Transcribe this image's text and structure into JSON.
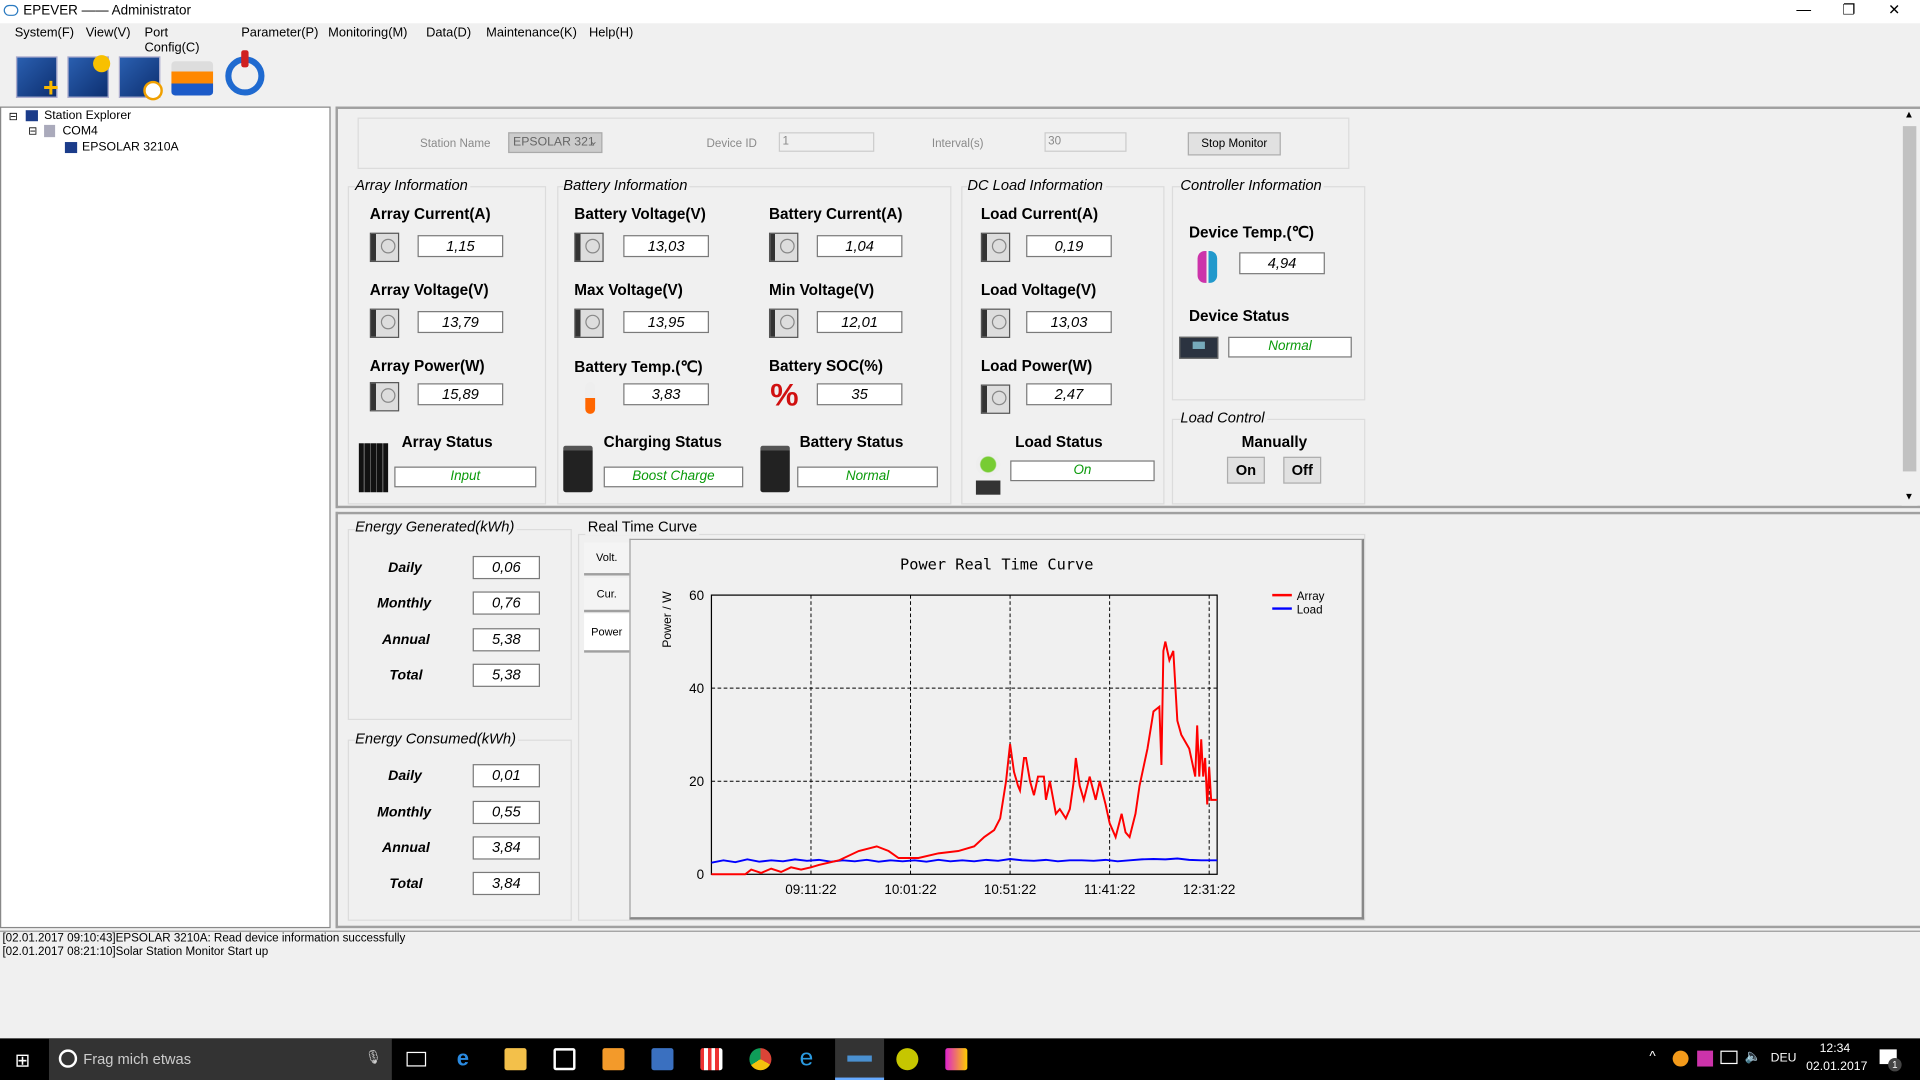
{
  "window": {
    "title": "EPEVER —— Administrator"
  },
  "menu": [
    "System(F)",
    "View(V)",
    "Port Config(C)",
    "Parameter(P)",
    "Monitoring(M)",
    "Data(D)",
    "Maintenance(K)",
    "Help(H)"
  ],
  "tree": {
    "root": "Station Explorer",
    "port": "COM4",
    "device": "EPSOLAR 3210A"
  },
  "config": {
    "station_name_label": "Station Name",
    "station_name": "EPSOLAR 321",
    "device_id_label": "Device ID",
    "device_id": "1",
    "interval_label": "Interval(s)",
    "interval": "30",
    "stop_button": "Stop Monitor"
  },
  "array": {
    "title": "Array Information",
    "current_label": "Array Current(A)",
    "current": "1,15",
    "voltage_label": "Array Voltage(V)",
    "voltage": "13,79",
    "power_label": "Array Power(W)",
    "power": "15,89",
    "status_label": "Array Status",
    "status": "Input"
  },
  "battery": {
    "title": "Battery Information",
    "voltage_label": "Battery Voltage(V)",
    "voltage": "13,03",
    "current_label": "Battery Current(A)",
    "current": "1,04",
    "max_label": "Max Voltage(V)",
    "max": "13,95",
    "min_label": "Min Voltage(V)",
    "min": "12,01",
    "temp_label": "Battery Temp.(℃)",
    "temp": "3,83",
    "soc_label": "Battery SOC(%)",
    "soc": "35",
    "charging_label": "Charging Status",
    "charging": "Boost Charge",
    "status_label": "Battery Status",
    "status": "Normal"
  },
  "load": {
    "title": "DC Load Information",
    "current_label": "Load Current(A)",
    "current": "0,19",
    "voltage_label": "Load Voltage(V)",
    "voltage": "13,03",
    "power_label": "Load Power(W)",
    "power": "2,47",
    "status_label": "Load Status",
    "status": "On"
  },
  "controller": {
    "title": "Controller Information",
    "temp_label": "Device Temp.(℃)",
    "temp": "4,94",
    "status_label": "Device Status",
    "status": "Normal"
  },
  "load_control": {
    "title": "Load Control",
    "mode": "Manually",
    "on": "On",
    "off": "Off"
  },
  "energy_generated": {
    "title": "Energy Generated(kWh)",
    "rows": [
      {
        "label": "Daily",
        "value": "0,06"
      },
      {
        "label": "Monthly",
        "value": "0,76"
      },
      {
        "label": "Annual",
        "value": "5,38"
      },
      {
        "label": "Total",
        "value": "5,38"
      }
    ]
  },
  "energy_consumed": {
    "title": "Energy Consumed(kWh)",
    "rows": [
      {
        "label": "Daily",
        "value": "0,01"
      },
      {
        "label": "Monthly",
        "value": "0,55"
      },
      {
        "label": "Annual",
        "value": "3,84"
      },
      {
        "label": "Total",
        "value": "3,84"
      }
    ]
  },
  "curve": {
    "title": "Real Time Curve",
    "tabs": [
      "Volt.",
      "Cur.",
      "Power"
    ]
  },
  "chart_data": {
    "type": "line",
    "title": "Power Real Time Curve",
    "ylabel": "Power / W",
    "xlabel": "",
    "ylim": [
      0,
      60
    ],
    "yticks": [
      0,
      20,
      40,
      60
    ],
    "xlim_minutes_from_start": [
      0,
      254
    ],
    "xticks": [
      {
        "min": 50,
        "label": "09:11:22"
      },
      {
        "min": 100,
        "label": "10:01:22"
      },
      {
        "min": 150,
        "label": "10:51:22"
      },
      {
        "min": 200,
        "label": "11:41:22"
      },
      {
        "min": 250,
        "label": "12:31:22"
      }
    ],
    "legend_position": "top-right",
    "grid": true,
    "series": [
      {
        "name": "Array",
        "color": "#ff0000",
        "points": [
          [
            0,
            0
          ],
          [
            17,
            0
          ],
          [
            20,
            1
          ],
          [
            25,
            0.3
          ],
          [
            30,
            1.2
          ],
          [
            35,
            0.5
          ],
          [
            40,
            1.5
          ],
          [
            45,
            1
          ],
          [
            50,
            1.5
          ],
          [
            54,
            2
          ],
          [
            64,
            3
          ],
          [
            74,
            5
          ],
          [
            83,
            6
          ],
          [
            89,
            5
          ],
          [
            94,
            3.5
          ],
          [
            104,
            3.5
          ],
          [
            114,
            4.5
          ],
          [
            124,
            5
          ],
          [
            132,
            6
          ],
          [
            137,
            8
          ],
          [
            142,
            9.5
          ],
          [
            145,
            12
          ],
          [
            148,
            20
          ],
          [
            150,
            28
          ],
          [
            152,
            22
          ],
          [
            154,
            19
          ],
          [
            155,
            18
          ],
          [
            157,
            25
          ],
          [
            158,
            25
          ],
          [
            160,
            20
          ],
          [
            162,
            17
          ],
          [
            164,
            21
          ],
          [
            167,
            21
          ],
          [
            168,
            16
          ],
          [
            170,
            20
          ],
          [
            173,
            13
          ],
          [
            175,
            14
          ],
          [
            178,
            12
          ],
          [
            180,
            14
          ],
          [
            182,
            20
          ],
          [
            183,
            25
          ],
          [
            185,
            19
          ],
          [
            187,
            16
          ],
          [
            190,
            21
          ],
          [
            193,
            16
          ],
          [
            195,
            20
          ],
          [
            198,
            15
          ],
          [
            200,
            11
          ],
          [
            203,
            8
          ],
          [
            206,
            13
          ],
          [
            208,
            9
          ],
          [
            210,
            8
          ],
          [
            213,
            13
          ],
          [
            215,
            19
          ],
          [
            219,
            27
          ],
          [
            222,
            35
          ],
          [
            225,
            36
          ],
          [
            226,
            23.5
          ],
          [
            227,
            48
          ],
          [
            228,
            50
          ],
          [
            230,
            46
          ],
          [
            232,
            48
          ],
          [
            234,
            33
          ],
          [
            236,
            30
          ],
          [
            240,
            27
          ],
          [
            243,
            21
          ],
          [
            244,
            32
          ],
          [
            245,
            21
          ],
          [
            246,
            29
          ],
          [
            247,
            21
          ],
          [
            248,
            25
          ],
          [
            249,
            15
          ],
          [
            250,
            23
          ],
          [
            251,
            16
          ],
          [
            254,
            16
          ]
        ]
      },
      {
        "name": "Load",
        "color": "#0000ff",
        "points": [
          [
            0,
            2.5
          ],
          [
            6,
            3
          ],
          [
            12,
            2.6
          ],
          [
            18,
            3.2
          ],
          [
            24,
            2.7
          ],
          [
            30,
            3
          ],
          [
            36,
            2.8
          ],
          [
            42,
            3.2
          ],
          [
            48,
            2.9
          ],
          [
            54,
            3.1
          ],
          [
            60,
            2.7
          ],
          [
            66,
            3
          ],
          [
            72,
            2.8
          ],
          [
            78,
            3.1
          ],
          [
            84,
            2.7
          ],
          [
            90,
            3
          ],
          [
            96,
            2.8
          ],
          [
            102,
            3
          ],
          [
            108,
            2.7
          ],
          [
            114,
            3.1
          ],
          [
            120,
            2.8
          ],
          [
            126,
            3
          ],
          [
            132,
            2.8
          ],
          [
            138,
            3.1
          ],
          [
            144,
            2.9
          ],
          [
            150,
            3.3
          ],
          [
            156,
            3
          ],
          [
            162,
            2.9
          ],
          [
            168,
            3.1
          ],
          [
            174,
            2.8
          ],
          [
            180,
            3
          ],
          [
            186,
            3
          ],
          [
            192,
            2.9
          ],
          [
            198,
            3.1
          ],
          [
            204,
            2.8
          ],
          [
            210,
            3
          ],
          [
            216,
            3.2
          ],
          [
            222,
            3.3
          ],
          [
            228,
            3.2
          ],
          [
            234,
            3.4
          ],
          [
            240,
            3.1
          ],
          [
            246,
            3
          ],
          [
            254,
            3
          ]
        ]
      }
    ]
  },
  "log": [
    "[02.01.2017 09:10:43]EPSOLAR 3210A: Read device information successfully",
    "[02.01.2017 08:21:10]Solar Station Monitor Start up"
  ],
  "taskbar": {
    "search_placeholder": "Frag mich etwas",
    "lang": "DEU",
    "time": "12:34",
    "date": "02.01.2017",
    "notifications": "1"
  }
}
